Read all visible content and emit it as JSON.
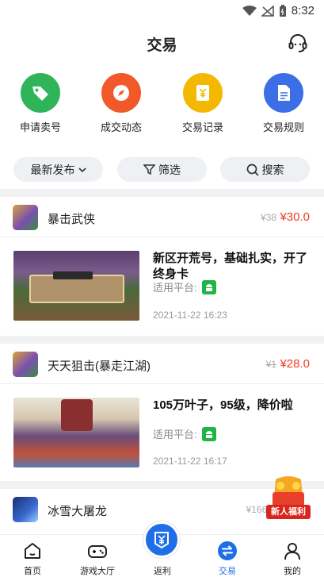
{
  "status": {
    "time": "8:32"
  },
  "header": {
    "title": "交易"
  },
  "quick_actions": [
    {
      "label": "申请卖号",
      "icon": "tag-icon",
      "color": "#2fb45a"
    },
    {
      "label": "成交动态",
      "icon": "compass-icon",
      "color": "#f1582a"
    },
    {
      "label": "交易记录",
      "icon": "yen-note-icon",
      "color": "#f5b800"
    },
    {
      "label": "交易规则",
      "icon": "document-icon",
      "color": "#3c6ee8"
    }
  ],
  "filters": {
    "sort_label": "最新发布",
    "filter_label": "筛选",
    "search_label": "搜索"
  },
  "listings": [
    {
      "game": "暴击武侠",
      "old_price": "¥38",
      "price": "¥30.0",
      "title": "新区开荒号，基础扎实，开了终身卡",
      "platform_label": "适用平台:",
      "time": "2021-11-22 16:23"
    },
    {
      "game": "天天狙击(暴走江湖)",
      "old_price": "¥1",
      "price": "¥28.0",
      "title": "105万叶子，95级，降价啦",
      "platform_label": "适用平台:",
      "time": "2021-11-22 16:17"
    },
    {
      "game": "冰雪大屠龙",
      "old_price": "¥1660",
      "price": ""
    }
  ],
  "promo": {
    "label": "新人福利"
  },
  "tabbar": {
    "items": [
      {
        "label": "首页",
        "icon": "home-icon"
      },
      {
        "label": "游戏大厅",
        "icon": "gamepad-icon"
      },
      {
        "label": "返利",
        "icon": "rebate-icon"
      },
      {
        "label": "交易",
        "icon": "exchange-icon"
      },
      {
        "label": "我的",
        "icon": "user-icon"
      }
    ],
    "active_color": "#1e6ee8"
  }
}
